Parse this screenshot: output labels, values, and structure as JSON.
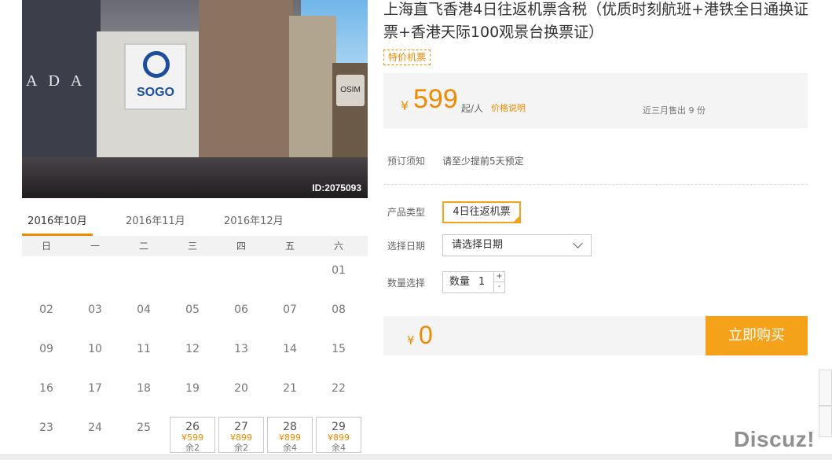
{
  "product": {
    "title": "上海直飞香港4日往返机票含税（优质时刻航班+港铁全日通换证票+香港天际100观景台换票证）",
    "tag": "特价机票",
    "photo_id": "ID:2075093",
    "photo_signs": {
      "sogo": "SOGO",
      "ada": "ADA",
      "osim": "OSIM"
    }
  },
  "price": {
    "currency": "¥",
    "amount": "599",
    "unit": "起/人",
    "note_link": "价格说明",
    "sold": "近三月售出 9 份"
  },
  "booking": {
    "notice_label": "预订须知",
    "notice_text": "请至少提前5天预定",
    "type_label": "产品类型",
    "type_value": "4日往返机票",
    "date_label": "选择日期",
    "date_placeholder": "请选择日期",
    "qty_label": "数量选择",
    "qty_text": "数量",
    "qty_value": "1",
    "plus": "+",
    "minus": "-"
  },
  "total": {
    "currency": "¥",
    "amount": "0"
  },
  "buy_button": "立即购买",
  "calendar": {
    "tabs": [
      "2016年10月",
      "2016年11月",
      "2016年12月"
    ],
    "weekdays": [
      "日",
      "一",
      "二",
      "三",
      "四",
      "五",
      "六"
    ],
    "rows": [
      [
        "",
        "",
        "",
        "",
        "",
        "",
        "01"
      ],
      [
        "02",
        "03",
        "04",
        "05",
        "06",
        "07",
        "08"
      ],
      [
        "09",
        "10",
        "11",
        "12",
        "13",
        "14",
        "15"
      ],
      [
        "16",
        "17",
        "18",
        "19",
        "20",
        "21",
        "22"
      ],
      [
        "23",
        "24",
        "25",
        "26",
        "27",
        "28",
        "29"
      ]
    ],
    "available": [
      {
        "day": "26",
        "price": "¥599",
        "left": "余2"
      },
      {
        "day": "27",
        "price": "¥899",
        "left": "余2"
      },
      {
        "day": "28",
        "price": "¥899",
        "left": "余4"
      },
      {
        "day": "29",
        "price": "¥899",
        "left": "余4"
      }
    ]
  },
  "watermark": "Discuz!",
  "colors": {
    "accent": "#f08a00",
    "button": "#f5a21b",
    "panel": "#f4f4f4"
  }
}
